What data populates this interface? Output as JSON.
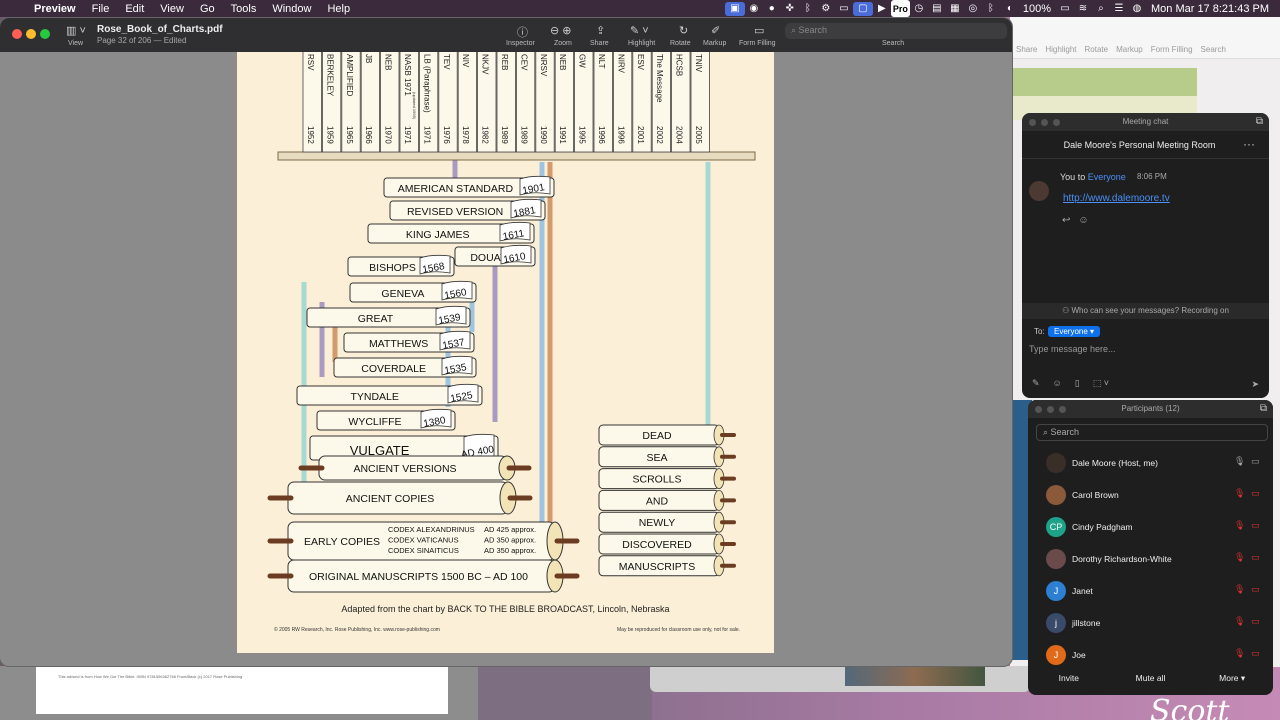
{
  "menubar": {
    "apple": "",
    "items": [
      "Preview",
      "File",
      "Edit",
      "View",
      "Go",
      "Tools",
      "Window",
      "Help"
    ],
    "status_icons": [
      "screen-share-icon",
      "zoom-icon",
      "record-dot-icon",
      "puzzle-icon",
      "bluetooth-alt-icon",
      "gear-icon",
      "display-icon",
      "mirror-icon",
      "play-icon",
      "pro-badge-icon",
      "clock-icon",
      "battery-tray-icon",
      "calendar-icon",
      "airdrop-icon",
      "bluetooth-icon",
      "volume-icon"
    ],
    "pro": "Pro",
    "battery": "100%",
    "datetime": "Mon Mar 17  8:21:43 PM"
  },
  "preview": {
    "title": "Rose_Book_of_Charts.pdf",
    "subtitle": "Page 32 of 206 — Edited",
    "view_label": "View",
    "toolbar": [
      "Inspector",
      "Zoom",
      "Share",
      "Highlight",
      "Rotate",
      "Markup",
      "Form Filling",
      "Search"
    ],
    "search_placeholder": "Search"
  },
  "chart": {
    "spines": [
      {
        "abbr": "RSV",
        "year": "1952"
      },
      {
        "abbr": "BERKELEY",
        "year": "1959"
      },
      {
        "abbr": "AMPLIFIED",
        "year": "1965"
      },
      {
        "abbr": "JB",
        "year": "1966"
      },
      {
        "abbr": "NEB",
        "year": "1970"
      },
      {
        "abbr": "NASB 1971",
        "year": "1971",
        "note": "(updated 1995)"
      },
      {
        "abbr": "LB (Paraphrase)",
        "year": "1971"
      },
      {
        "abbr": "TEV",
        "year": "1976"
      },
      {
        "abbr": "NIV",
        "year": "1978"
      },
      {
        "abbr": "NKJV",
        "year": "1982"
      },
      {
        "abbr": "REB",
        "year": "1989"
      },
      {
        "abbr": "CEV",
        "year": "1989"
      },
      {
        "abbr": "NRSV",
        "year": "1990"
      },
      {
        "abbr": "NEB",
        "year": "1991"
      },
      {
        "abbr": "GW",
        "year": "1995"
      },
      {
        "abbr": "NLT",
        "year": "1996"
      },
      {
        "abbr": "NIRV",
        "year": "1996"
      },
      {
        "abbr": "ESV",
        "year": "2001"
      },
      {
        "abbr": "The Message",
        "year": "2002"
      },
      {
        "abbr": "HCSB",
        "year": "2004"
      },
      {
        "abbr": "TNIV",
        "year": "2005"
      }
    ],
    "books": [
      {
        "name": "AMERICAN STANDARD",
        "year": "1901"
      },
      {
        "name": "REVISED VERSION",
        "year": "1881"
      },
      {
        "name": "KING JAMES",
        "year": "1611"
      },
      {
        "name": "BISHOPS",
        "year": "1568"
      },
      {
        "name": "DOUAY",
        "year": "1610"
      },
      {
        "name": "GENEVA",
        "year": "1560"
      },
      {
        "name": "GREAT",
        "year": "1539"
      },
      {
        "name": "MATTHEWS",
        "year": "1537"
      },
      {
        "name": "COVERDALE",
        "year": "1535"
      },
      {
        "name": "TYNDALE",
        "year": "1525"
      },
      {
        "name": "WYCLIFFE",
        "year": "1380"
      },
      {
        "name": "VULGATE",
        "year": "AD 400"
      }
    ],
    "scrolls": [
      {
        "name": "ANCIENT VERSIONS"
      },
      {
        "name": "ANCIENT COPIES"
      },
      {
        "name": "EARLY COPIES",
        "codices": [
          {
            "name": "CODEX ALEXANDRINUS",
            "date": "AD 425 approx."
          },
          {
            "name": "CODEX VATICANUS",
            "date": "AD 350 approx."
          },
          {
            "name": "CODEX SINAITICUS",
            "date": "AD 350 approx."
          }
        ]
      },
      {
        "name": "ORIGINAL MANUSCRIPTS",
        "date": "1500 BC –  AD 100"
      }
    ],
    "dss": [
      "DEAD",
      "SEA",
      "SCROLLS",
      "AND",
      "NEWLY",
      "DISCOVERED",
      "MANUSCRIPTS"
    ],
    "colors": {
      "page": "#fbf0d7",
      "book": "#fdf9ea",
      "shelf": "#e8dcc0",
      "teal": "#a8d8d2",
      "orange": "#d49a6e",
      "purple": "#a89ac0",
      "blue": "#9ec4e0",
      "rod": "#6b3c22"
    }
  },
  "footer": {
    "main": "Adapted from the chart by BACK TO THE BIBLE BROADCAST, Lincoln, Nebraska",
    "left": "© 2005 RW Research, Inc. Rose Publishing, Inc.          www.rose-publishing.com",
    "right": "May be reproduced for classroom use only, not for sale."
  },
  "bg_doc": {
    "fine_print": "This ad/sect is from How We Got The Bible. ISBN 9781596362766 Front/Back (c) 2017 Rose Publishing"
  },
  "bg_window_toolbar": [
    "Share",
    "Highlight",
    "Rotate",
    "Markup",
    "Form Filling",
    "Search"
  ],
  "chat": {
    "window_title": "Meeting chat",
    "room": "Dale Moore's Personal Meeting Room",
    "from_prefix": "You to ",
    "to": "Everyone",
    "time": "8:06 PM",
    "link": "http://www.dalemoore.tv",
    "who_can_see": "Who can see your messages? Recording on",
    "to_label": "To:",
    "recipient": "Everyone ▾",
    "placeholder": "Type message here..."
  },
  "participants": {
    "title": "Participants (12)",
    "search_placeholder": "Search",
    "list": [
      {
        "name": "Dale Moore (Host, me)",
        "initials": "",
        "color": "#3a2e28"
      },
      {
        "name": "Carol Brown",
        "initials": "",
        "color": "#8a5a3a"
      },
      {
        "name": "Cindy Padgham",
        "initials": "CP",
        "color": "#1fa28a"
      },
      {
        "name": "Dorothy Richardson-White",
        "initials": "",
        "color": "#6a4a4a"
      },
      {
        "name": "Janet",
        "initials": "J",
        "color": "#2d7fd1"
      },
      {
        "name": "jillstone",
        "initials": "j",
        "color": "#3a4a6a"
      },
      {
        "name": "Joe",
        "initials": "J",
        "color": "#e06a1a"
      }
    ],
    "buttons": [
      "Invite",
      "Mute all",
      "More ▾"
    ]
  },
  "desktop": {
    "signature": "Scott"
  }
}
